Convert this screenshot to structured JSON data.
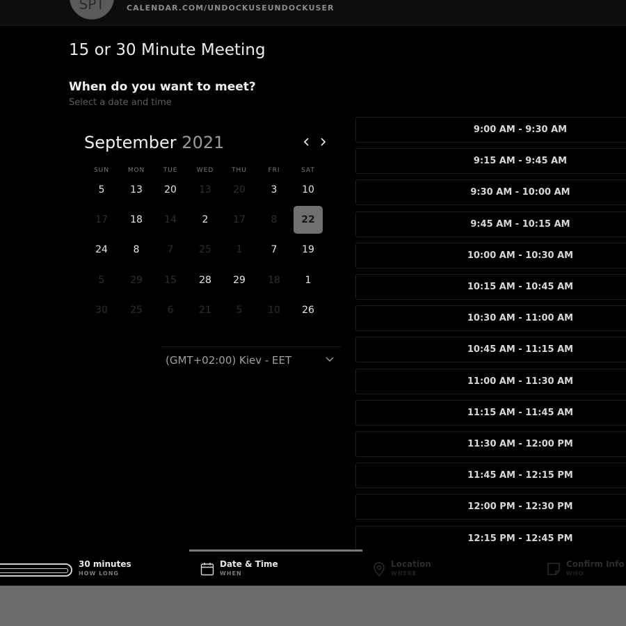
{
  "header": {
    "avatar_initials": "SPT",
    "calendar_url": "CALENDAR.COM/UNDOCKUSEUNDOCKUSER"
  },
  "meeting": {
    "title": "15 or 30 Minute Meeting",
    "prompt": "When do you want to meet?",
    "subprompt": "Select a date and time"
  },
  "calendar": {
    "month": "September",
    "year": "2021",
    "weekdays": [
      "SUN",
      "MON",
      "TUE",
      "WED",
      "THU",
      "FRI",
      "SAT"
    ],
    "rows": [
      [
        {
          "d": "5",
          "a": true
        },
        {
          "d": "13",
          "a": true
        },
        {
          "d": "20",
          "a": true
        },
        {
          "d": "13",
          "a": false
        },
        {
          "d": "20",
          "a": false
        },
        {
          "d": "3",
          "a": true
        },
        {
          "d": "10",
          "a": true
        }
      ],
      [
        {
          "d": "17",
          "a": false
        },
        {
          "d": "18",
          "a": true
        },
        {
          "d": "14",
          "a": false
        },
        {
          "d": "2",
          "a": true
        },
        {
          "d": "17",
          "a": false
        },
        {
          "d": "8",
          "a": false
        },
        {
          "d": "22",
          "a": true,
          "selected": true
        }
      ],
      [
        {
          "d": "24",
          "a": true
        },
        {
          "d": "8",
          "a": true
        },
        {
          "d": "7",
          "a": false
        },
        {
          "d": "25",
          "a": false
        },
        {
          "d": "1",
          "a": false
        },
        {
          "d": "7",
          "a": true
        },
        {
          "d": "19",
          "a": true
        }
      ],
      [
        {
          "d": "5",
          "a": false
        },
        {
          "d": "29",
          "a": false
        },
        {
          "d": "15",
          "a": false
        },
        {
          "d": "28",
          "a": true
        },
        {
          "d": "29",
          "a": true
        },
        {
          "d": "18",
          "a": false
        },
        {
          "d": "1",
          "a": true
        }
      ],
      [
        {
          "d": "30",
          "a": false
        },
        {
          "d": "25",
          "a": false
        },
        {
          "d": "6",
          "a": false
        },
        {
          "d": "21",
          "a": false
        },
        {
          "d": "5",
          "a": false
        },
        {
          "d": "10",
          "a": false
        },
        {
          "d": "26",
          "a": true
        }
      ]
    ],
    "prev_icon": "chevron-left-icon",
    "next_icon": "chevron-right-icon"
  },
  "timezone": {
    "label": "(GMT+02:00) Kiev - EET",
    "icon": "chevron-down-icon"
  },
  "time_slots": [
    "9:00 AM - 9:30 AM",
    "9:15 AM - 9:45 AM",
    "9:30 AM - 10:00 AM",
    "9:45 AM - 10:15 AM",
    "10:00 AM - 10:30 AM",
    "10:15 AM - 10:45 AM",
    "10:30 AM - 11:00 AM",
    "10:45 AM - 11:15 AM",
    "11:00 AM - 11:30 AM",
    "11:15 AM - 11:45 AM",
    "11:30 AM - 12:00 PM",
    "11:45 AM - 12:15 PM",
    "12:00 PM - 12:30 PM",
    "12:15 PM - 12:45 PM"
  ],
  "steps": [
    {
      "label": "30 minutes",
      "caption": "HOW LONG",
      "icon": "duration-pill-icon",
      "state": "done"
    },
    {
      "label": "Date & Time",
      "caption": "WHEN",
      "icon": "calendar-icon",
      "state": "active"
    },
    {
      "label": "Location",
      "caption": "WHERE",
      "icon": "location-pin-icon",
      "state": "pending"
    },
    {
      "label": "Confirm Info",
      "caption": "WHO",
      "icon": "note-icon",
      "state": "pending"
    }
  ],
  "colors": {
    "background": "#000000",
    "selected_day": "#707070",
    "footer": "#6b6b6b",
    "progress": "#7a7a7a"
  }
}
